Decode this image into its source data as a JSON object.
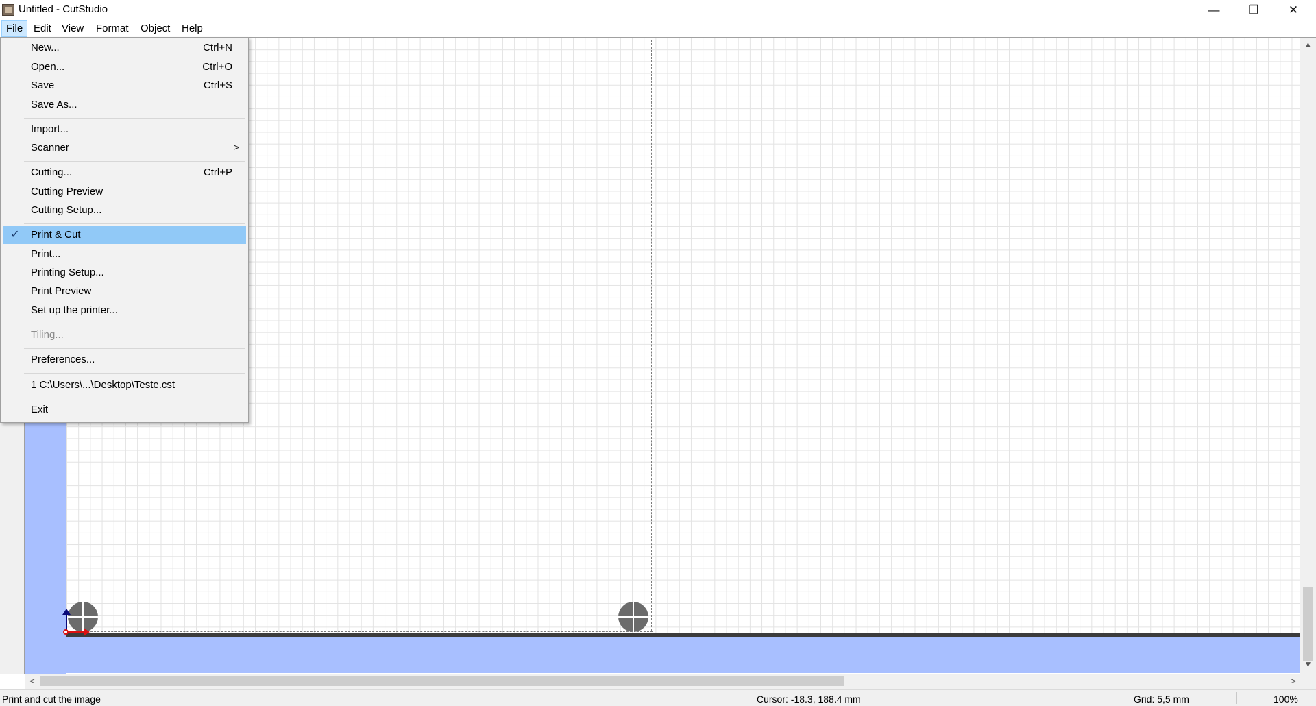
{
  "window": {
    "title": "Untitled - CutStudio",
    "minimize_glyph": "—",
    "maximize_glyph": "❐",
    "close_glyph": "✕"
  },
  "menubar": {
    "items": [
      "File",
      "Edit",
      "View",
      "Format",
      "Object",
      "Help"
    ],
    "active": "File"
  },
  "file_menu": {
    "items": [
      {
        "label": "New...",
        "shortcut": "Ctrl+N"
      },
      {
        "label": "Open...",
        "shortcut": "Ctrl+O"
      },
      {
        "label": "Save",
        "shortcut": "Ctrl+S"
      },
      {
        "label": "Save As...",
        "shortcut": ""
      },
      {
        "label": "Import...",
        "shortcut": ""
      },
      {
        "label": "Scanner",
        "shortcut": "",
        "submenu_glyph": ">"
      },
      {
        "label": "Cutting...",
        "shortcut": "Ctrl+P"
      },
      {
        "label": "Cutting Preview",
        "shortcut": ""
      },
      {
        "label": "Cutting Setup...",
        "shortcut": ""
      },
      {
        "label": "Print & Cut",
        "shortcut": "",
        "checked": true,
        "check_glyph": "✓"
      },
      {
        "label": "Print...",
        "shortcut": ""
      },
      {
        "label": "Printing Setup...",
        "shortcut": ""
      },
      {
        "label": "Print Preview",
        "shortcut": ""
      },
      {
        "label": "Set up the printer...",
        "shortcut": ""
      },
      {
        "label": "Tiling...",
        "shortcut": "",
        "disabled": true
      },
      {
        "label": "Preferences...",
        "shortcut": ""
      },
      {
        "label": "1 C:\\Users\\...\\Desktop\\Teste.cst",
        "shortcut": ""
      },
      {
        "label": "Exit",
        "shortcut": ""
      }
    ]
  },
  "scrollbars": {
    "up_glyph": "▲",
    "down_glyph": "▼",
    "left_glyph": "<",
    "right_glyph": ">"
  },
  "statusbar": {
    "message": "Print and cut the image",
    "cursor": "Cursor: -18.3, 188.4 mm",
    "grid": "Grid: 5,5 mm",
    "zoom": "100%"
  },
  "colors": {
    "menu_highlight": "#91c9f7",
    "media_area": "#a8bfff",
    "registration_mark": "#6b6b6b"
  }
}
